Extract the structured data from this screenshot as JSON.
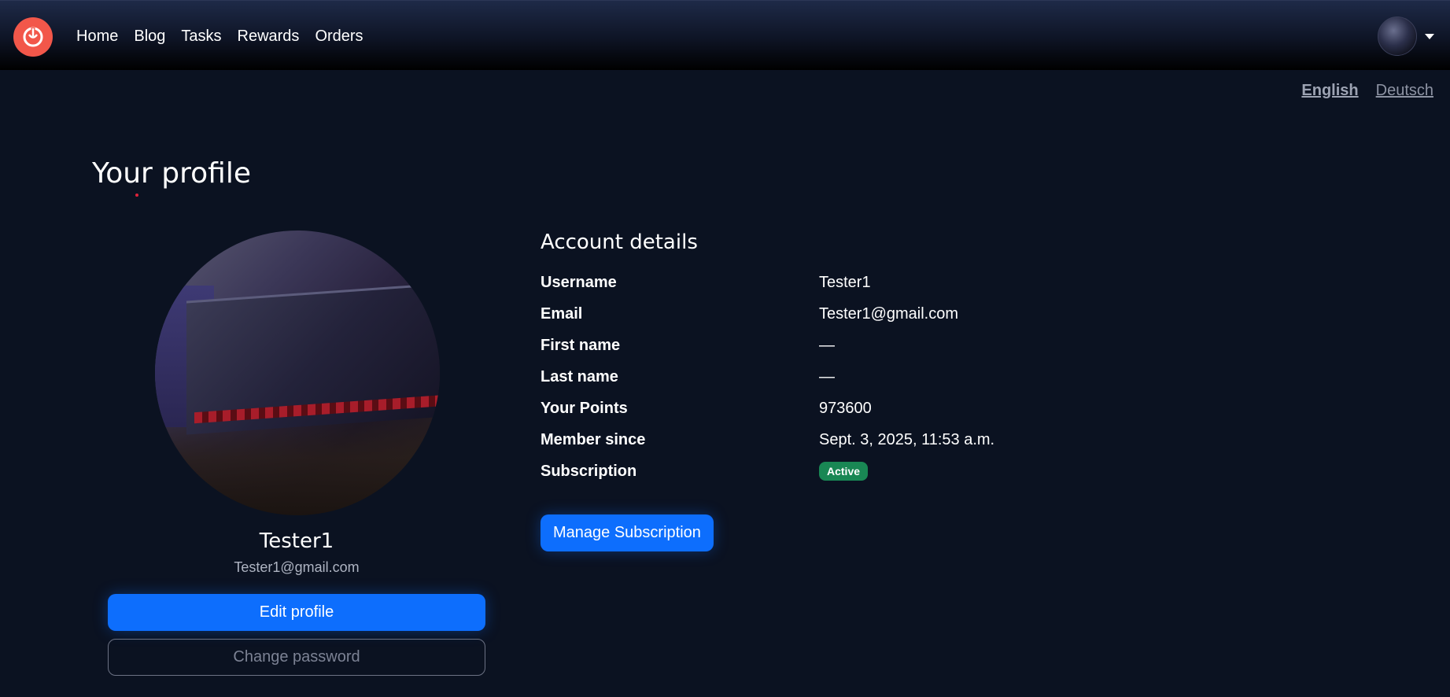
{
  "nav": {
    "logo_icon": "power-swirl-logo",
    "links": [
      "Home",
      "Blog",
      "Tasks",
      "Rewards",
      "Orders"
    ]
  },
  "languages": {
    "english": "English",
    "deutsch": "Deutsch"
  },
  "page": {
    "title": "Your profile"
  },
  "profile": {
    "name": "Tester1",
    "email": "Tester1@gmail.com",
    "edit_label": "Edit profile",
    "change_password_label": "Change password"
  },
  "account": {
    "title": "Account details",
    "rows": [
      {
        "label": "Username",
        "value": "Tester1"
      },
      {
        "label": "Email",
        "value": "Tester1@gmail.com"
      },
      {
        "label": "First name",
        "value": "—"
      },
      {
        "label": "Last name",
        "value": "—"
      },
      {
        "label": "Your Points",
        "value": "973600"
      },
      {
        "label": "Member since",
        "value": "Sept. 3, 2025, 11:53 a.m."
      },
      {
        "label": "Subscription",
        "value": "Active"
      }
    ],
    "manage_label": "Manage Subscription"
  },
  "colors": {
    "accent": "#0d6efd",
    "logo": "#f2574a",
    "badge_active": "#198754",
    "background": "#0b1221"
  }
}
